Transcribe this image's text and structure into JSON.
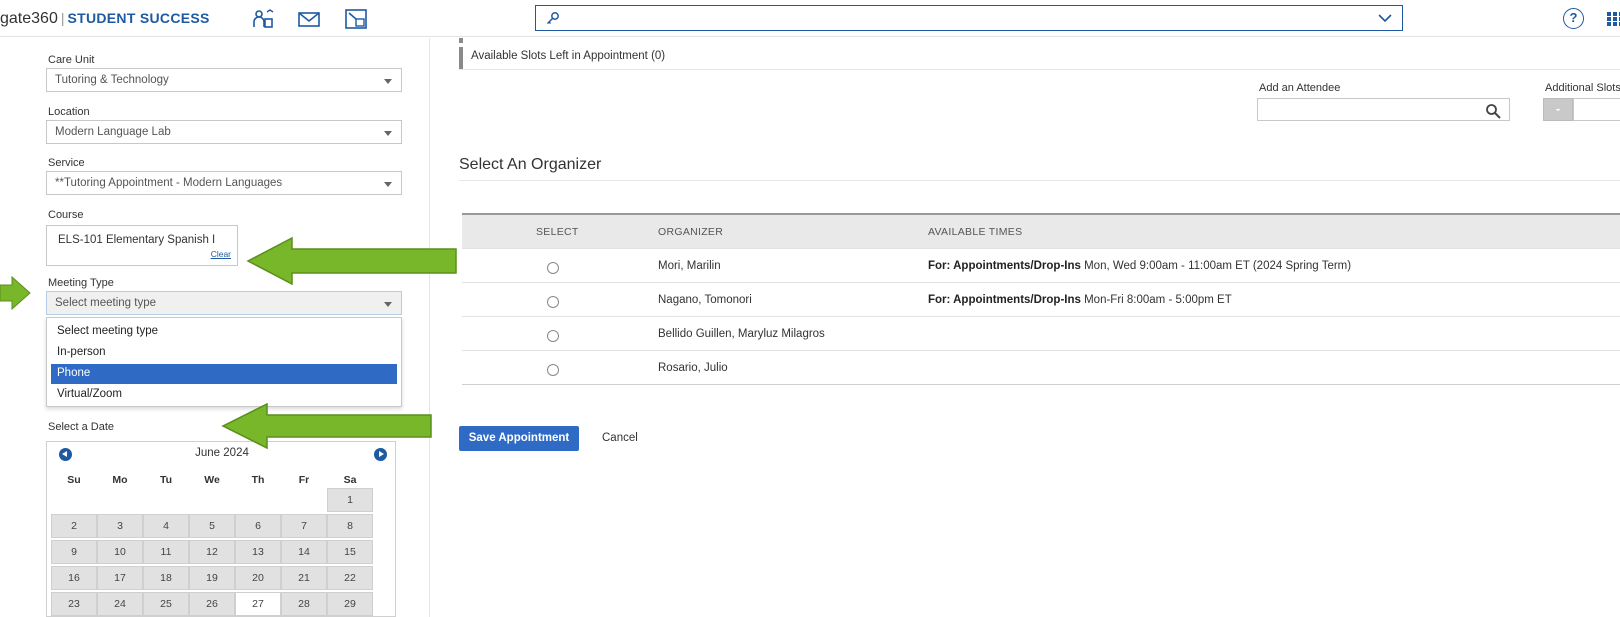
{
  "header": {
    "brand_name": "gate360",
    "separator": "|",
    "product_name": "STUDENT SUCCESS",
    "search_placeholder": "",
    "help_label": "?"
  },
  "form": {
    "care_unit": {
      "label": "Care Unit",
      "value": "Tutoring & Technology"
    },
    "location": {
      "label": "Location",
      "value": "Modern Language Lab"
    },
    "service": {
      "label": "Service",
      "value": "**Tutoring Appointment - Modern Languages"
    },
    "course": {
      "label": "Course",
      "value": "ELS-101 Elementary Spanish I",
      "clear_label": "Clear"
    },
    "meeting_type": {
      "label": "Meeting Type",
      "value": "Select meeting type",
      "options": [
        "Select meeting type",
        "In-person",
        "Phone",
        "Virtual/Zoom"
      ],
      "highlighted": "Phone"
    },
    "date": {
      "label": "Select a Date",
      "month_title": "June 2024",
      "weekdays": [
        "Su",
        "Mo",
        "Tu",
        "We",
        "Th",
        "Fr",
        "Sa"
      ],
      "days": [
        [
          "",
          "",
          "",
          "",
          "",
          "",
          "1"
        ],
        [
          "2",
          "3",
          "4",
          "5",
          "6",
          "7",
          "8"
        ],
        [
          "9",
          "10",
          "11",
          "12",
          "13",
          "14",
          "15"
        ],
        [
          "16",
          "17",
          "18",
          "19",
          "20",
          "21",
          "22"
        ],
        [
          "23",
          "24",
          "25",
          "26",
          "27",
          "28",
          "29"
        ]
      ],
      "today": "27"
    }
  },
  "appointment": {
    "slots_text": "Available Slots Left in Appointment (0)",
    "add_attendee_label": "Add an Attendee",
    "additional_slots_label": "Additional Slots",
    "stepper_minus": "-"
  },
  "organizer": {
    "title": "Select An Organizer",
    "columns": [
      "SELECT",
      "ORGANIZER",
      "AVAILABLE TIMES"
    ],
    "rows": [
      {
        "name": "Mori, Marilin",
        "times_prefix": "For: Appointments/Drop-Ins",
        "times": " Mon, Wed 9:00am - 11:00am ET (2024 Spring Term)"
      },
      {
        "name": "Nagano, Tomonori",
        "times_prefix": "For: Appointments/Drop-Ins",
        "times": " Mon-Fri 8:00am - 5:00pm ET"
      },
      {
        "name": "Bellido Guillen, Maryluz Milagros",
        "times_prefix": "",
        "times": ""
      },
      {
        "name": "Rosario, Julio",
        "times_prefix": "",
        "times": ""
      }
    ]
  },
  "actions": {
    "save_label": "Save Appointment",
    "cancel_label": "Cancel"
  },
  "colors": {
    "brand_blue": "#1d5aa3",
    "selected_option": "#2f6bc4",
    "annotation_arrow": "#78b62a"
  }
}
